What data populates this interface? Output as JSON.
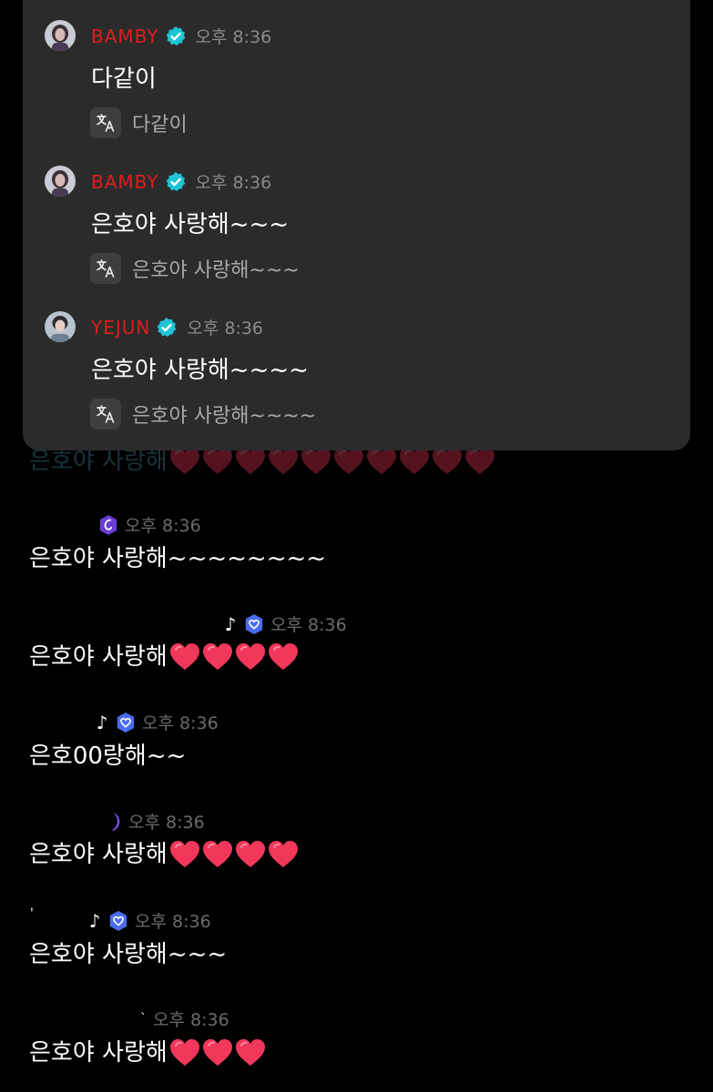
{
  "overlay": {
    "messages": [
      {
        "username": "BAMBY",
        "time": "오후 8:36",
        "text": "다같이",
        "translation": "다같이"
      },
      {
        "username": "BAMBY",
        "time": "오후 8:36",
        "text": "은호야 사랑해~~~",
        "translation": "은호야 사랑해~~~"
      },
      {
        "username": "YEJUN",
        "time": "오후 8:36",
        "text": "은호야 사랑해~~~~",
        "translation": "은호야 사랑해~~~~"
      }
    ]
  },
  "chat": {
    "faded_text": "은호야 사랑해",
    "faded_hearts": 10,
    "messages": [
      {
        "time": "오후 8:36",
        "badge": "purple-shield-icon",
        "text": "은호야 사랑해~~~~~~~~",
        "hearts": 0
      },
      {
        "time": "오후 8:36",
        "badge": "blue-heart-badge-icon",
        "text": "은호야 사랑해",
        "hearts": 4
      },
      {
        "time": "오후 8:36",
        "badge": "blue-heart-badge-icon",
        "text": "은호00랑해~~",
        "hearts": 0
      },
      {
        "time": "오후 8:36",
        "badge": "crescent-moon-icon",
        "text": "은호야 사랑해",
        "hearts": 4
      },
      {
        "time": "오후 8:36",
        "badge": "blue-heart-badge-icon",
        "text": "은호야 사랑해~~~",
        "hearts": 0
      },
      {
        "time": "오후 8:36",
        "badge": "none",
        "text": "은호야 사랑해",
        "hearts": 3
      }
    ]
  },
  "colors": {
    "username": "#e01e1e",
    "verify_badge": "#1ec3d6",
    "panel_bg": "#2b2b2b",
    "heart": "#f2385a"
  }
}
